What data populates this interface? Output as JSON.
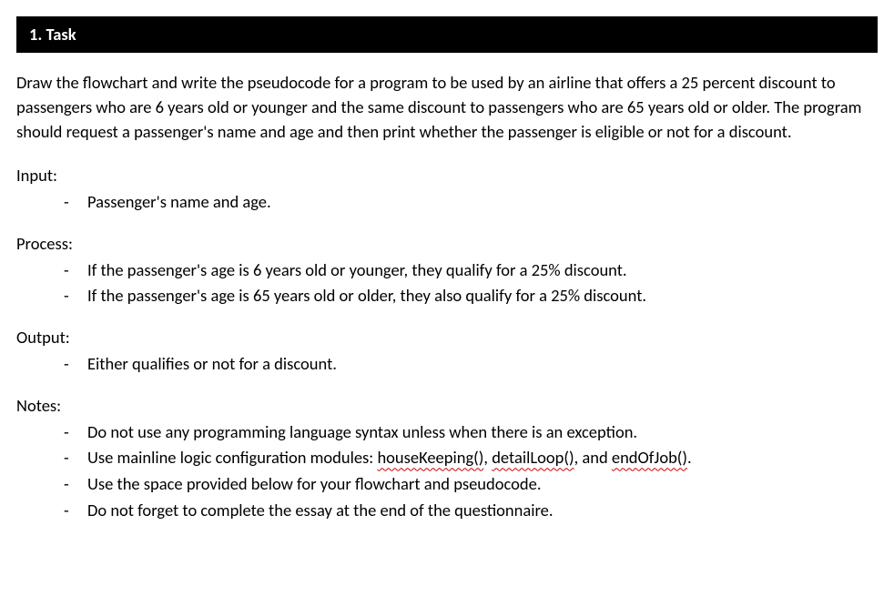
{
  "header": {
    "title": "1. Task"
  },
  "intro": "Draw the flowchart and write the pseudocode for a program to be used by an airline that offers a 25 percent discount to passengers who are 6 years old or younger and the same discount to passengers who are 65 years old or older. The program should request a passenger's name and age and then print whether the passenger is eligible or not for a discount.",
  "sections": {
    "input": {
      "label": "Input:",
      "items": [
        "Passenger's name and age."
      ]
    },
    "process": {
      "label": "Process:",
      "items": [
        "If the passenger's age is 6 years old or younger, they qualify for a 25% discount.",
        "If the passenger's age is 65 years old or older, they also qualify for a 25% discount."
      ]
    },
    "output": {
      "label": "Output:",
      "items": [
        "Either qualifies or not for a discount."
      ]
    },
    "notes": {
      "label": "Notes:",
      "items": [
        "Do not use any programming language syntax unless when there is an exception.",
        "Use mainline logic configuration modules: ",
        "Use the space provided below for your flowchart and pseudocode.",
        "Do not forget to complete the essay at the end of the questionnaire."
      ],
      "modules": {
        "m1": "houseKeeping()",
        "sep1": ", ",
        "m2": "detailLoop()",
        "sep2": ", and ",
        "m3": "endOfJob()",
        "tail": "."
      }
    }
  }
}
